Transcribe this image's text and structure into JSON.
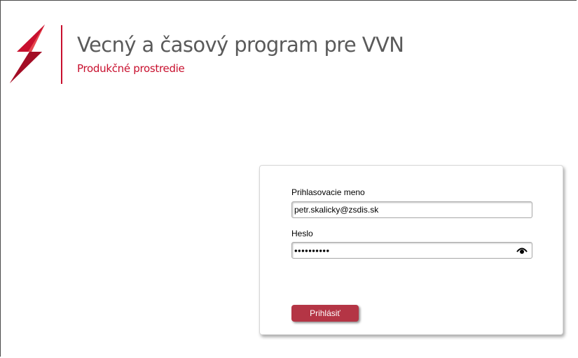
{
  "header": {
    "logo_icon": "lightning-bolt-icon",
    "title": "Vecný a časový program pre VVN",
    "subtitle": "Produkčné prostredie",
    "brand_color": "#c8102e"
  },
  "login": {
    "username_label": "Prihlasovacie meno",
    "username_value": "petr.skalicky@zsdis.sk",
    "password_label": "Heslo",
    "password_value": "••••••••••",
    "show_password_icon": "eye-icon",
    "submit_label": "Prihlásiť",
    "button_color": "#b43545"
  }
}
